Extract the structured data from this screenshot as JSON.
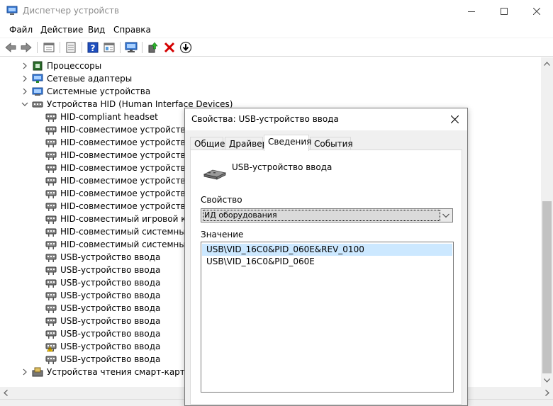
{
  "window": {
    "title": "Диспетчер устройств"
  },
  "menu": [
    "Файл",
    "Действие",
    "Вид",
    "Справка"
  ],
  "toolbar_icons": [
    "back-arrow-icon",
    "forward-arrow-icon",
    "properties-icon",
    "details-icon",
    "help-icon",
    "view-icon",
    "monitor-icon",
    "update-driver-icon",
    "uninstall-x-icon",
    "disable-down-icon"
  ],
  "tree": {
    "categories_top": [
      {
        "label": "Процессоры",
        "icon": "processor-icon"
      },
      {
        "label": "Сетевые адаптеры",
        "icon": "network-adapter-icon"
      },
      {
        "label": "Системные устройства",
        "icon": "system-device-icon"
      },
      {
        "label": "Устройства HID (Human Interface Devices)",
        "icon": "hid-icon"
      }
    ],
    "hid_children": [
      {
        "label": "HID-compliant headset",
        "warning": false
      },
      {
        "label": "HID-совместимое устройство уп",
        "warning": false
      },
      {
        "label": "HID-совместимое устройство уп",
        "warning": false
      },
      {
        "label": "HID-совместимое устройство уп",
        "warning": false
      },
      {
        "label": "HID-совместимое устройство, с",
        "warning": false
      },
      {
        "label": "HID-совместимое устройство, с",
        "warning": false
      },
      {
        "label": "HID-совместимое устройство, с",
        "warning": false
      },
      {
        "label": "HID-совместимое устройство, с",
        "warning": false
      },
      {
        "label": "HID-совместимый игровой конт",
        "warning": false
      },
      {
        "label": "HID-совместимый системный к",
        "warning": false
      },
      {
        "label": "HID-совместимый системный к",
        "warning": false
      },
      {
        "label": "USB-устройство ввода",
        "warning": false
      },
      {
        "label": "USB-устройство ввода",
        "warning": false
      },
      {
        "label": "USB-устройство ввода",
        "warning": false
      },
      {
        "label": "USB-устройство ввода",
        "warning": false
      },
      {
        "label": "USB-устройство ввода",
        "warning": false
      },
      {
        "label": "USB-устройство ввода",
        "warning": false
      },
      {
        "label": "USB-устройство ввода",
        "warning": false
      },
      {
        "label": "USB-устройство ввода",
        "warning": true
      },
      {
        "label": "USB-устройство ввода",
        "warning": false
      }
    ],
    "categories_bottom": [
      {
        "label": "Устройства чтения смарт-карт",
        "icon": "smartcard-reader-icon"
      }
    ]
  },
  "dialog": {
    "title": "Свойства: USB-устройство ввода",
    "tabs": [
      "Общие",
      "Драйвер",
      "Сведения",
      "События"
    ],
    "active_tab": "Сведения",
    "device_name": "USB-устройство ввода",
    "property_label": "Свойство",
    "property_value": "ИД оборудования",
    "value_label": "Значение",
    "values": [
      "USB\\VID_16C0&PID_060E&REV_0100",
      "USB\\VID_16C0&PID_060E"
    ],
    "selected_value_index": 0
  },
  "colors": {
    "selection": "#cce8ff",
    "warning": "#f5c400",
    "uninstall": "#d40000",
    "help": "#1f4fbf"
  }
}
